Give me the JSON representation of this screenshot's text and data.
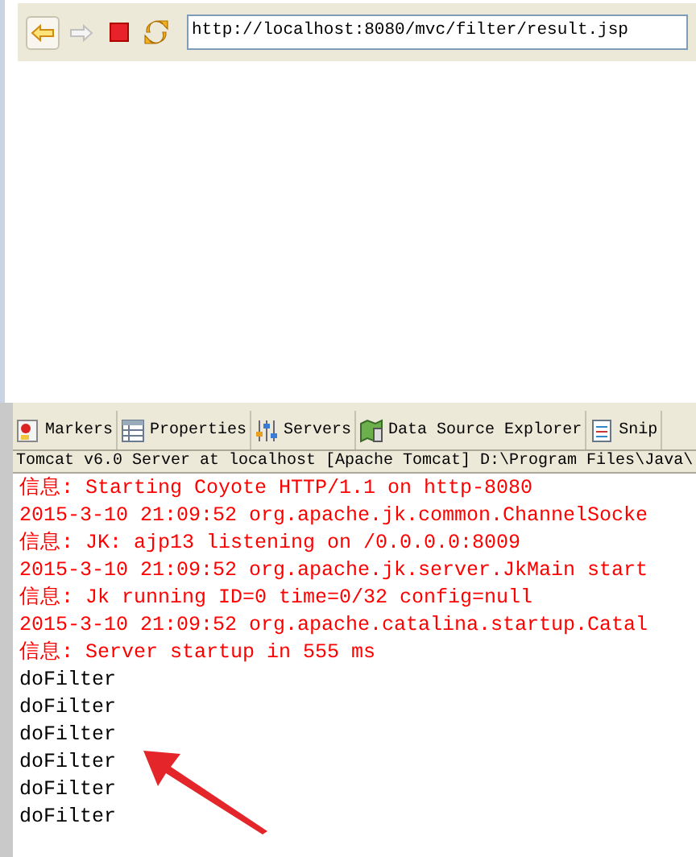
{
  "browser": {
    "address": "http://localhost:8080/mvc/filter/result.jsp"
  },
  "views": {
    "tabs": [
      {
        "label": "Markers"
      },
      {
        "label": "Properties"
      },
      {
        "label": "Servers"
      },
      {
        "label": "Data Source Explorer"
      },
      {
        "label": "Snip"
      }
    ]
  },
  "console": {
    "header": "Tomcat v6.0 Server at localhost [Apache Tomcat] D:\\Program Files\\Java\\",
    "lines": [
      {
        "kind": "err",
        "text": "信息: Starting Coyote HTTP/1.1 on http-8080"
      },
      {
        "kind": "err",
        "text": "2015-3-10 21:09:52 org.apache.jk.common.ChannelSocke"
      },
      {
        "kind": "err",
        "text": "信息: JK: ajp13 listening on /0.0.0.0:8009"
      },
      {
        "kind": "err",
        "text": "2015-3-10 21:09:52 org.apache.jk.server.JkMain start"
      },
      {
        "kind": "err",
        "text": "信息: Jk running ID=0 time=0/32  config=null"
      },
      {
        "kind": "err",
        "text": "2015-3-10 21:09:52 org.apache.catalina.startup.Catal"
      },
      {
        "kind": "err",
        "text": "信息: Server startup in 555 ms"
      },
      {
        "kind": "out",
        "text": "doFilter"
      },
      {
        "kind": "out",
        "text": "doFilter"
      },
      {
        "kind": "out",
        "text": "doFilter"
      },
      {
        "kind": "out",
        "text": "doFilter"
      },
      {
        "kind": "out",
        "text": "doFilter"
      },
      {
        "kind": "out",
        "text": "doFilter"
      }
    ]
  }
}
